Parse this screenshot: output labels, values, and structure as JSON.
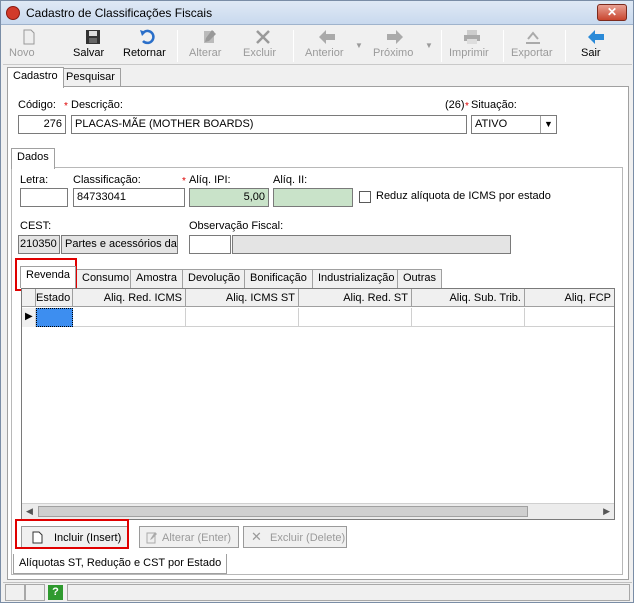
{
  "window": {
    "title": "Cadastro de Classificações Fiscais",
    "close_glyph": "✕"
  },
  "toolbar": {
    "novo": "Novo",
    "salvar": "Salvar",
    "retornar": "Retornar",
    "alterar": "Alterar",
    "excluir": "Excluir",
    "anterior": "Anterior",
    "proximo": "Próximo",
    "imprimir": "Imprimir",
    "exportar": "Exportar",
    "sair": "Sair"
  },
  "main_tabs": {
    "cadastro": "Cadastro",
    "pesquisar": "Pesquisar"
  },
  "form": {
    "codigo_label": "Código:",
    "codigo_value": "276",
    "descricao_label": "Descrição:",
    "descricao_value": "PLACAS-MÃE (MOTHER BOARDS)",
    "desc_count": "(26)",
    "situacao_label": "Situação:",
    "situacao_value": "ATIVO"
  },
  "dados_tab": "Dados",
  "dados": {
    "letra_label": "Letra:",
    "letra_value": "",
    "classificacao_label": "Classificação:",
    "classificacao_value": "84733041",
    "aliq_ipi_label": "Alíq. IPI:",
    "aliq_ipi_value": "5,00",
    "aliq_ii_label": "Alíq. II:",
    "aliq_ii_value": "",
    "reduz_label": "Reduz alíquota de ICMS por estado",
    "cest_label": "CEST:",
    "cest_code": "210350",
    "cest_desc": "Partes e acessórios das",
    "obs_label": "Observação Fiscal:",
    "obs_code": "",
    "obs_desc": ""
  },
  "sub_tabs": [
    "Revenda",
    "Consumo",
    "Amostra",
    "Devolução",
    "Bonificação",
    "Industrialização",
    "Outras"
  ],
  "grid": {
    "columns": [
      "Estado",
      "Aliq. Red. ICMS",
      "Aliq. ICMS ST",
      "Aliq. Red. ST",
      "Aliq. Sub. Trib.",
      "Aliq. FCP"
    ]
  },
  "buttons": {
    "incluir": "Incluir (Insert)",
    "alterar": "Alterar (Enter)",
    "excluir": "Excluir (Delete)"
  },
  "bottom_tab": "Alíquotas ST, Redução e CST por Estado",
  "status": {
    "help": "?"
  },
  "colors": {
    "highlight": "#e00000",
    "green_field": "#c9e3c9",
    "selected_cell": "#3d8ef0"
  }
}
